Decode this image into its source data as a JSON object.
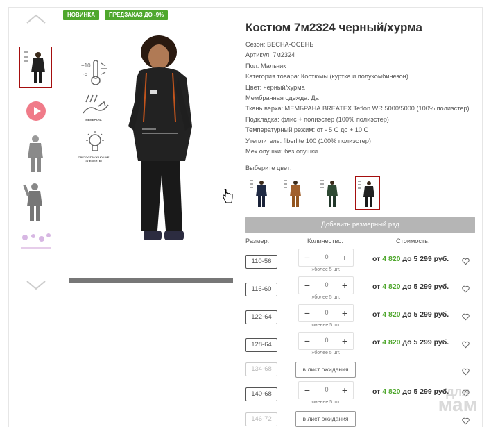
{
  "badges": [
    "НОВИНКА",
    "ПРЕДЗАКАЗ ДО -9%"
  ],
  "product": {
    "title": "Костюм 7м2324 черный/хурма",
    "props": [
      "Сезон: ВЕСНА-ОСЕНЬ",
      "Артикул: 7м2324",
      "Пол: Мальчик",
      "Категория товара: Костюмы (куртка и полукомбинезон)",
      "Цвет: черный/хурма",
      "Мембранная одежда: Да",
      "Ткань верха: МЕМБРАНА BREATEX Teflon WR 5000/5000 (100% полиэстер)",
      "Подкладка: флис + полиэстер (100% полиэстер)",
      "Температурный режим: от - 5 С до + 10 С",
      "Утеплитель: fiberlite 100 (100% полиэстер)",
      "Мех опушки: без опушки"
    ]
  },
  "features": {
    "temp_top": "+10",
    "temp_bottom": "-5",
    "membrane": "МЕМБРАНА",
    "reflect": "СВЕТООТРАЖАЮЩИЕ ЭЛЕМЕНТЫ"
  },
  "choose_color_label": "Выберите цвет:",
  "add_size_row_label": "Добавить размерный ряд",
  "table_headers": {
    "size": "Размер:",
    "qty": "Количество:",
    "price": "Стоимость:"
  },
  "rows": [
    {
      "size": "110-56",
      "available": true,
      "qty": "0",
      "stock": "»более 5 шт.",
      "price_prefix": "от",
      "price_low": "4 820",
      "price_mid": "до",
      "price_high": "5 299 руб."
    },
    {
      "size": "116-60",
      "available": true,
      "qty": "0",
      "stock": "»более 5 шт.",
      "price_prefix": "от",
      "price_low": "4 820",
      "price_mid": "до",
      "price_high": "5 299 руб."
    },
    {
      "size": "122-64",
      "available": true,
      "qty": "0",
      "stock": "»менее 5 шт.",
      "price_prefix": "от",
      "price_low": "4 820",
      "price_mid": "до",
      "price_high": "5 299 руб."
    },
    {
      "size": "128-64",
      "available": true,
      "qty": "0",
      "stock": "»более 5 шт.",
      "price_prefix": "от",
      "price_low": "4 820",
      "price_mid": "до",
      "price_high": "5 299 руб."
    },
    {
      "size": "134-68",
      "available": false,
      "wait_label": "в лист ожидания"
    },
    {
      "size": "140-68",
      "available": true,
      "qty": "0",
      "stock": "»менее 5 шт.",
      "price_prefix": "от",
      "price_low": "4 820",
      "price_mid": "до",
      "price_high": "5 299 руб."
    },
    {
      "size": "146-72",
      "available": false,
      "wait_label": "в лист ожидания"
    }
  ],
  "stepper": {
    "minus": "−",
    "plus": "+"
  },
  "watermark": {
    "line1": "для",
    "line2": "мам"
  },
  "colors": {
    "accent_green": "#4fa72d",
    "active_border": "#a50e0e",
    "button_gray": "#b5b5b5"
  }
}
